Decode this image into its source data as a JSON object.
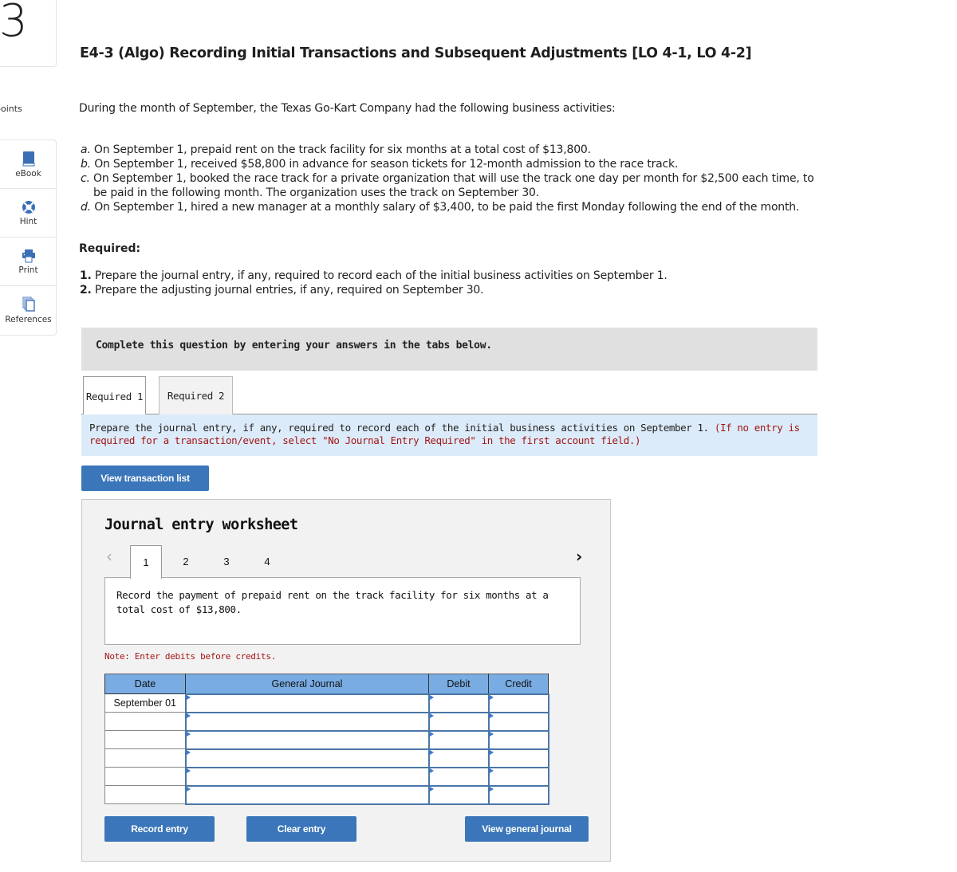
{
  "question": {
    "number": "3",
    "points_label": "points",
    "title": "E4-3 (Algo) Recording Initial Transactions and Subsequent Adjustments [LO 4-1, LO 4-2]",
    "intro": "During the month of September, the Texas Go-Kart Company had the following business activities:",
    "activities": [
      {
        "letter": "a.",
        "text": " On September 1, prepaid rent on the track facility for six months at a total cost of $13,800."
      },
      {
        "letter": "b.",
        "text": " On September 1, received $58,800 in advance for season tickets for 12-month admission to the race track."
      },
      {
        "letter": "c.",
        "text": " On September 1, booked the race track for a private organization that will use the track one day per month for $2,500 each time, to be paid in the following month. The organization uses the track on September 30."
      },
      {
        "letter": "d.",
        "text": " On September 1, hired a new manager at a monthly salary of $3,400, to be paid the first Monday following the end of the month."
      }
    ],
    "required_heading": "Required:",
    "required_items": [
      {
        "num": "1.",
        "text": " Prepare the journal entry, if any, required to record each of the initial business activities on September 1."
      },
      {
        "num": "2.",
        "text": " Prepare the adjusting journal entries, if any, required on September 30."
      }
    ]
  },
  "sidebar": {
    "tools": [
      {
        "icon": "book-icon",
        "label": "eBook"
      },
      {
        "icon": "lifebuoy-icon",
        "label": "Hint"
      },
      {
        "icon": "printer-icon",
        "label": "Print"
      },
      {
        "icon": "copy-icon",
        "label": "References"
      }
    ]
  },
  "instructions_bar": "Complete this question by entering your answers in the tabs below.",
  "tabs": [
    {
      "label": "Required 1",
      "active": true
    },
    {
      "label": "Required 2",
      "active": false
    }
  ],
  "prompt": {
    "text": "Prepare the journal entry, if any, required to record each of the initial business activities on September 1. ",
    "note": "(If no entry is required for a transaction/event, select \"No Journal Entry Required\" in the first account field.)"
  },
  "buttons": {
    "view_transaction_list": "View transaction list",
    "record_entry": "Record entry",
    "clear_entry": "Clear entry",
    "view_general_journal": "View general journal"
  },
  "worksheet": {
    "title": "Journal entry worksheet",
    "steps": [
      "1",
      "2",
      "3",
      "4"
    ],
    "active_step": "1",
    "prev_glyph": "‹",
    "next_glyph": "›",
    "description": "Record the payment of prepaid rent on the track facility for six months at a total cost of $13,800.",
    "note": "Note: Enter debits before credits.",
    "table": {
      "headers": [
        "Date",
        "General Journal",
        "Debit",
        "Credit"
      ],
      "rows": [
        {
          "date": "September 01",
          "account": "",
          "debit": "",
          "credit": ""
        },
        {
          "date": "",
          "account": "",
          "debit": "",
          "credit": ""
        },
        {
          "date": "",
          "account": "",
          "debit": "",
          "credit": ""
        },
        {
          "date": "",
          "account": "",
          "debit": "",
          "credit": ""
        },
        {
          "date": "",
          "account": "",
          "debit": "",
          "credit": ""
        },
        {
          "date": "",
          "account": "",
          "debit": "",
          "credit": ""
        }
      ]
    }
  },
  "colors": {
    "button_blue": "#3a76b9",
    "table_header_blue": "#79ace3",
    "prompt_bg": "#dcebf9",
    "note_red": "#a31515",
    "instr_bar_gray": "#e0e0e0"
  }
}
